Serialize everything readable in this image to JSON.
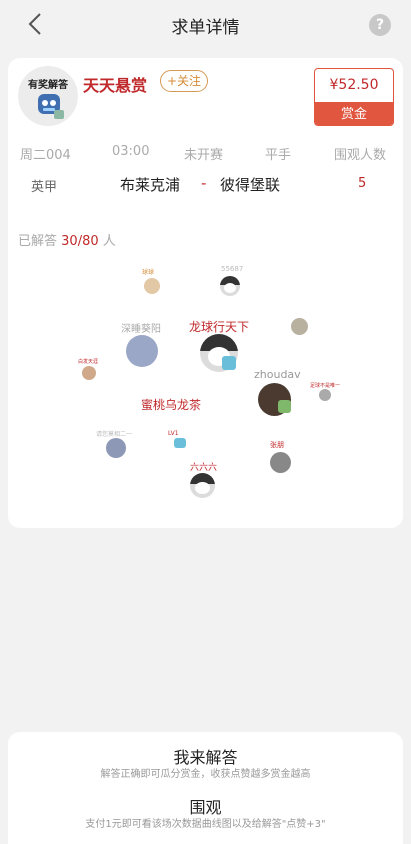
{
  "header": {
    "title": "求单详情",
    "help_label": "?"
  },
  "poster": {
    "avatar_badge": "有奖解答",
    "level": "LV1",
    "name": "天天悬赏",
    "follow_label": "+关注"
  },
  "reward": {
    "amount": "¥52.50",
    "label": "赏金"
  },
  "match": {
    "code": "周二004",
    "time": "03:00",
    "status": "未开赛",
    "play_type": "平手",
    "watchers_label": "围观人数",
    "league": "英甲",
    "home": "布莱克浦",
    "separator": "-",
    "away": "彼得堡联",
    "watchers": "5"
  },
  "answered": {
    "prefix": "已解答",
    "count": "30/80",
    "suffix": "人"
  },
  "answerers": [
    {
      "name": "龙球行天下",
      "badge": "LV1"
    },
    {
      "name": "深睡葵阳",
      "badge": ""
    },
    {
      "name": "zhoudav",
      "badge": "LV1"
    },
    {
      "name": "蜜桃乌龙茶",
      "badge": ""
    },
    {
      "name": "六六六",
      "badge": ""
    },
    {
      "name": "55687",
      "badge": ""
    },
    {
      "name": "球球",
      "badge": ""
    },
    {
      "name": "张朋",
      "badge": ""
    },
    {
      "name": "请您莫相二一",
      "badge": ""
    },
    {
      "name": "白发天涯",
      "badge": ""
    },
    {
      "name": "足球不是唯一",
      "badge": ""
    },
    {
      "name": "LV1",
      "badge": ""
    }
  ],
  "actions": {
    "answer_title": "我来解答",
    "answer_sub": "解答正确即可瓜分赏金，收获点赞越多赏金越高",
    "watch_title": "围观",
    "watch_sub": "支付1元即可看该场次数据曲线图以及给解答\"点赞+3\""
  },
  "colors": {
    "accent_red": "#c0292b",
    "reward_orange": "#e0563f",
    "follow_gold": "#d58a35"
  }
}
